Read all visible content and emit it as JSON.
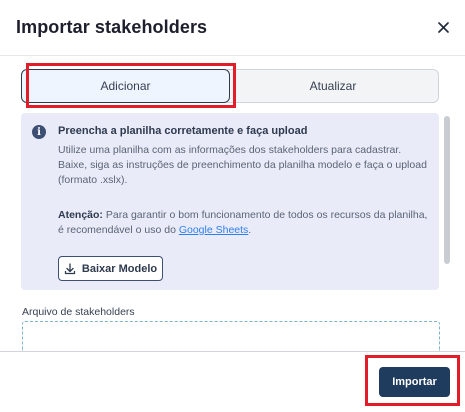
{
  "modal": {
    "title": "Importar stakeholders"
  },
  "tabs": [
    {
      "label": "Adicionar",
      "selected": true
    },
    {
      "label": "Atualizar",
      "selected": false
    }
  ],
  "info": {
    "title": "Preencha a planilha corretamente e faça upload",
    "text": "Utilize uma planilha com as informações dos stakeholders para cadastrar. Baixe, siga as instruções de preenchimento da planilha modelo e faça o upload (formato .xslx).",
    "warning_label": "Atenção:",
    "warning_text": " Para garantir o bom funcionamento de todos os recursos da planilha, é recomendável o uso do ",
    "link_text": "Google Sheets",
    "warning_end": ".",
    "download_label": "Baixar Modelo"
  },
  "upload": {
    "label": "Arquivo de stakeholders"
  },
  "footer": {
    "import_label": "Importar"
  },
  "colors": {
    "primary": "#1f3b5e",
    "info_bg": "#e9ebf9",
    "highlight": "#e11d2a",
    "link": "#2f80ed"
  }
}
